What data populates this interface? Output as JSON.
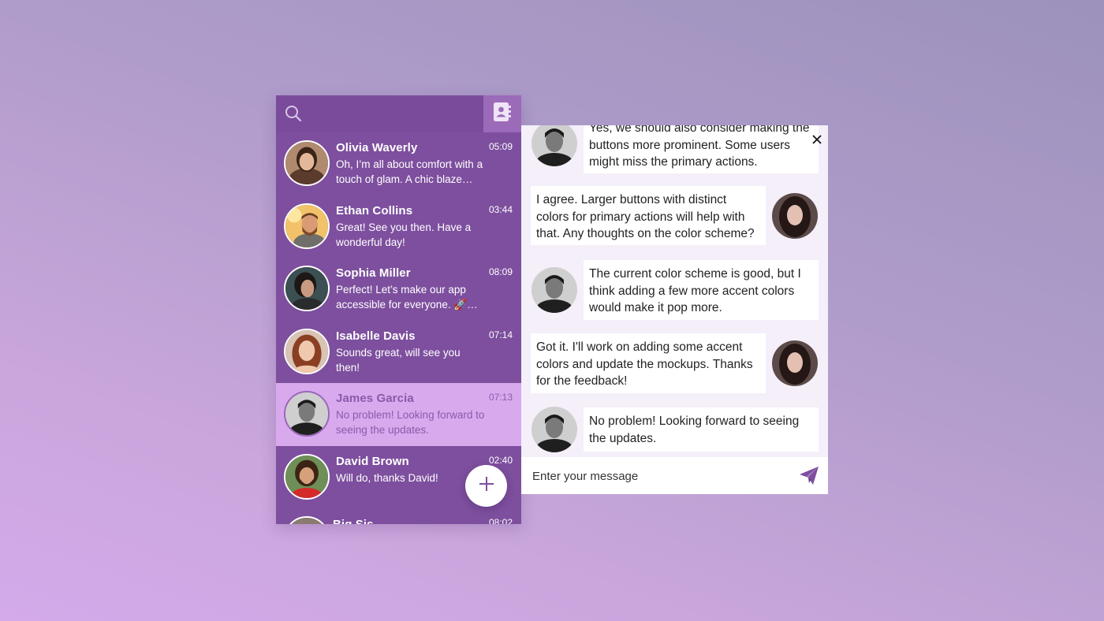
{
  "colors": {
    "accent": "#7d4f9e",
    "active_row": "#d9a9ee",
    "active_text": "#8a5aa9",
    "chat_bg": "#f4eff9"
  },
  "header": {
    "search_icon": "search-icon",
    "contacts_icon": "address-book-icon"
  },
  "contacts": [
    {
      "name": "Olivia Waverly",
      "time": "05:09",
      "message": "Oh, I’m all about comfort with a touch of glam. A chic blaze…"
    },
    {
      "name": "Ethan Collins",
      "time": "03:44",
      "message": "Great! See you then. Have a wonderful day!"
    },
    {
      "name": "Sophia Miller",
      "time": "08:09",
      "message": "Perfect! Let’s make our app accessible for everyone. 🚀…"
    },
    {
      "name": "Isabelle Davis",
      "time": "07:14",
      "message": "Sounds great, will see you then!"
    },
    {
      "name": "James Garcia",
      "time": "07:13",
      "message": "No problem! Looking forward to seeing the updates.",
      "active": true
    },
    {
      "name": "David Brown",
      "time": "02:40",
      "message": "Will do, thanks David!"
    },
    {
      "name": "Big Sis",
      "time": "08:02",
      "message": ""
    }
  ],
  "fab": {
    "icon": "plus-icon"
  },
  "chat": {
    "messages": [
      {
        "from": "them",
        "text": "Yes, we should also consider making the buttons more prominent. Some users might miss the primary actions."
      },
      {
        "from": "me",
        "text": "I agree. Larger buttons with distinct colors for primary actions will help with that. Any thoughts on the color scheme?"
      },
      {
        "from": "them",
        "text": "The current color scheme is good, but I think adding a few more accent colors would make it pop more."
      },
      {
        "from": "me",
        "text": "Got it. I'll work on adding some accent colors and update the mockups. Thanks for the feedback!"
      },
      {
        "from": "them",
        "text": "No problem! Looking forward to seeing the updates."
      }
    ],
    "composer_placeholder": "Enter your message",
    "send_icon": "paper-plane-icon",
    "close_icon": "close-icon"
  }
}
